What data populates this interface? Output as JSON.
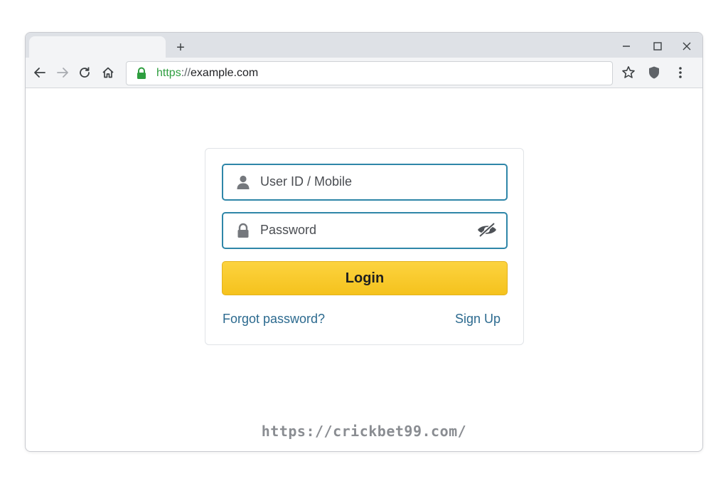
{
  "browser": {
    "tab": {
      "title": ""
    },
    "new_tab_label": "+",
    "window_controls": {
      "minimize_icon": "minimize-icon",
      "maximize_icon": "maximize-icon",
      "close_icon": "close-icon"
    },
    "toolbar": {
      "back_icon": "back-arrow-icon",
      "forward_icon": "forward-arrow-icon",
      "reload_icon": "reload-icon",
      "home_icon": "home-icon",
      "bookmark_icon": "star-icon",
      "extension_icon": "shield-icon",
      "menu_icon": "kebab-menu-icon"
    },
    "address_bar": {
      "secure_icon": "lock-icon",
      "scheme": "https",
      "separator": "://",
      "host": "example.com"
    }
  },
  "login_form": {
    "user_field": {
      "placeholder": "User ID / Mobile",
      "value": "",
      "icon": "user-icon"
    },
    "password_field": {
      "placeholder": "Password",
      "value": "",
      "icon": "lock-icon",
      "toggle_icon": "eye-slash-icon"
    },
    "login_label": "Login",
    "forgot_label": "Forgot password?",
    "signup_label": "Sign Up"
  },
  "watermark": "https://crickbet99.com/",
  "colors": {
    "accent_border": "#2e86a8",
    "login_button": "#f8c82a",
    "link": "#2c6a8f",
    "secure_green": "#2e9e3f"
  }
}
